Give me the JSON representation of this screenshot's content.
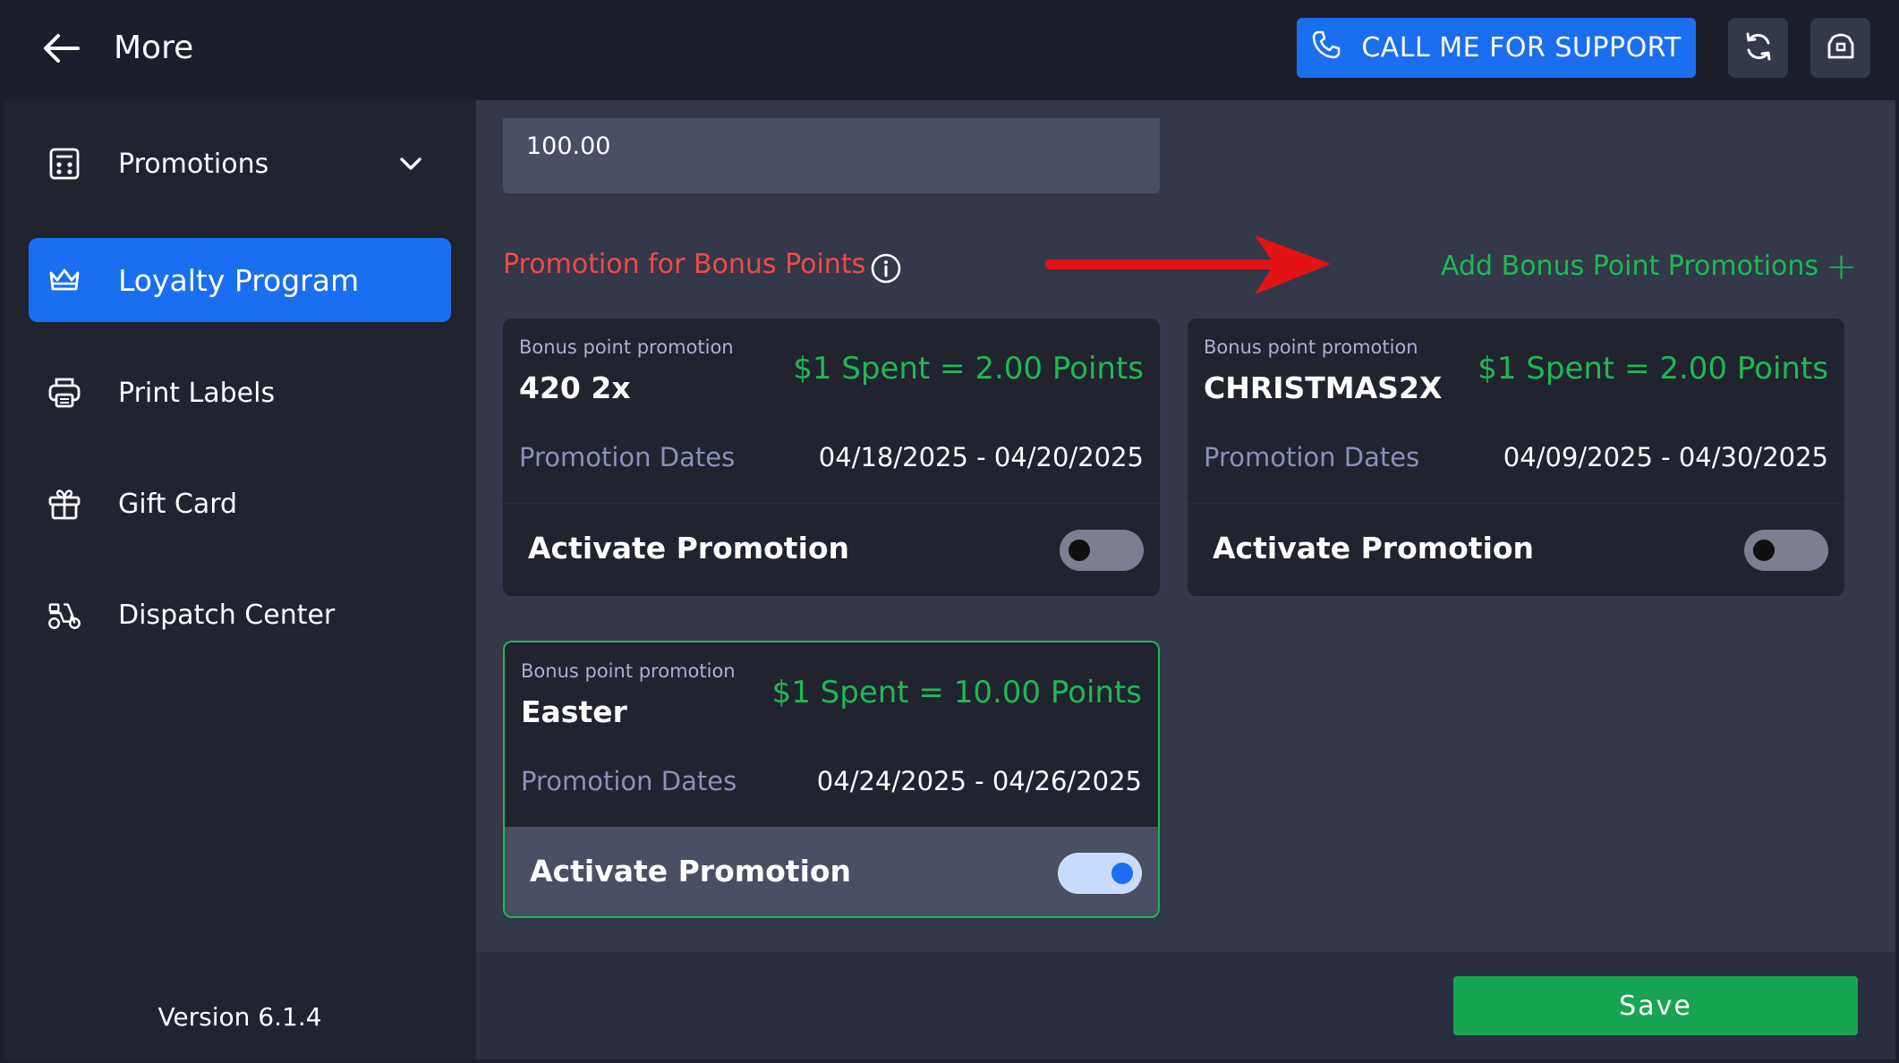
{
  "header": {
    "title": "More",
    "support_label": "CALL ME FOR SUPPORT"
  },
  "sidebar": {
    "items": [
      {
        "label": "Promotions",
        "icon": "promotions-icon"
      },
      {
        "label": "Loyalty Program",
        "icon": "crown-icon",
        "active": true
      },
      {
        "label": "Print Labels",
        "icon": "printer-icon"
      },
      {
        "label": "Gift Card",
        "icon": "gift-icon"
      },
      {
        "label": "Dispatch Center",
        "icon": "scooter-icon"
      }
    ],
    "version": "Version 6.1.4"
  },
  "main": {
    "amount_value": "100.00",
    "section_title": "Promotion for Bonus Points",
    "add_label": "Add Bonus Point Promotions",
    "add_plus": "+",
    "cards": [
      {
        "caption": "Bonus point promotion",
        "name": "420 2x",
        "rate": "$1 Spent = 2.00 Points",
        "dates_label": "Promotion Dates",
        "dates": "04/18/2025 - 04/20/2025",
        "activate_label": "Activate Promotion",
        "active": false
      },
      {
        "caption": "Bonus point promotion",
        "name": "CHRISTMAS2X",
        "rate": "$1 Spent = 2.00 Points",
        "dates_label": "Promotion Dates",
        "dates": "04/09/2025 - 04/30/2025",
        "activate_label": "Activate Promotion",
        "active": false
      },
      {
        "caption": "Bonus point promotion",
        "name": "Easter",
        "rate": "$1 Spent = 10.00 Points",
        "dates_label": "Promotion Dates",
        "dates": "04/24/2025 - 04/26/2025",
        "activate_label": "Activate Promotion",
        "active": true
      }
    ]
  },
  "footer": {
    "save_label": "Save"
  },
  "colors": {
    "accent": "#1a6ff0",
    "green": "#1db954",
    "red": "#ef4a4a",
    "annotation_arrow": "#e31313"
  }
}
